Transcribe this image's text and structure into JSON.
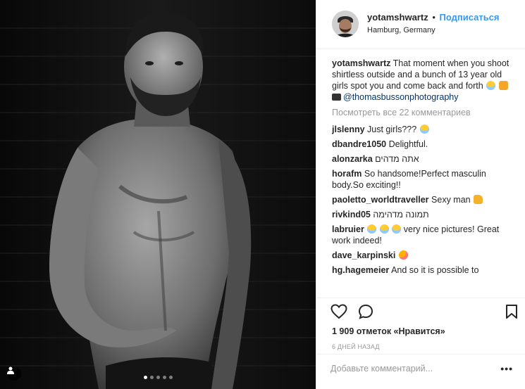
{
  "post": {
    "author": "yotamshwartz",
    "follow_label": "Подписаться",
    "separator": "•",
    "location": "Hamburg, Germany",
    "caption": "That moment when you shoot shirtless outside and a bunch of 13 year old girls spot you and come back and forth",
    "photo_credit": "@thomasbussonphotography",
    "view_all_comments": "Посмотреть все 22 комментариев",
    "likes": "1 909 отметок «Нравится»",
    "time_ago": "6 ДНЕЙ НАЗАД",
    "add_comment_placeholder": "Добавьте комментарий...",
    "more_options": "•••",
    "carousel": {
      "count": 5,
      "active_index": 0
    }
  },
  "comments": [
    {
      "user": "jlslenny",
      "text": "Just girls???",
      "emoji": "laugh"
    },
    {
      "user": "dbandre1050",
      "text": "Delightful."
    },
    {
      "user": "alonzarka",
      "text": "אתה מדהים",
      "rtl": true
    },
    {
      "user": "horafm",
      "text": "So handsome!Perfect masculin body.So exciting!!"
    },
    {
      "user": "paoletto_worldtraveller",
      "text": "Sexy man",
      "emoji": "thumb"
    },
    {
      "user": "rivkind05",
      "text": "תמונה מדהימה",
      "rtl": true
    },
    {
      "user": "labruier",
      "text": "very nice pictures! Great work indeed!"
    },
    {
      "user": "dave_karpinski",
      "text": ""
    },
    {
      "user": "hg.hagemeier",
      "text": "And so it is possible to"
    }
  ],
  "icons": {
    "like": "heart-outline-icon",
    "comment": "speech-bubble-icon",
    "save": "bookmark-icon",
    "tag": "person-tag-icon"
  },
  "colors": {
    "accent": "#3897f0",
    "muted": "#999999",
    "text": "#262626",
    "link": "#003569"
  }
}
